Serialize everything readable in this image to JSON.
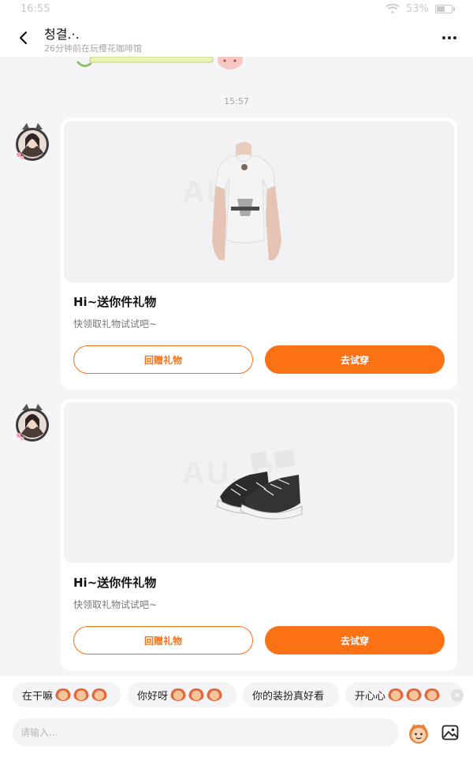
{
  "status_bar": {
    "time": "16:55",
    "battery": "53%",
    "battery_level": 0.53
  },
  "header": {
    "title": "청결.·.",
    "subtitle": "26分钟前在玩樱花咖啡馆"
  },
  "timestamp": "15:57",
  "messages": [
    {
      "kind": "top",
      "title": "Hi~送你件礼物",
      "subtitle": "快领取礼物试试吧~",
      "btn_return": "回赠礼物",
      "btn_try": "去试穿",
      "watermark": "AU..R"
    },
    {
      "kind": "shoes",
      "title": "Hi~送你件礼物",
      "subtitle": "快领取礼物试试吧~",
      "btn_return": "回赠礼物",
      "btn_try": "去试穿",
      "watermark": "AU..R"
    }
  ],
  "quick_replies": [
    {
      "text": "在干嘛"
    },
    {
      "text": "你好呀"
    },
    {
      "text": "你的装扮真好看"
    },
    {
      "text": "开心心"
    }
  ],
  "input": {
    "placeholder": "请输入..."
  },
  "colors": {
    "accent": "#fb7214",
    "background": "#f5f5f7"
  },
  "icons": {
    "back": "chevron-left-icon",
    "more": "more-dots-icon",
    "emoji": "emoji-icon",
    "image": "image-icon",
    "clear": "close-circle-icon"
  }
}
